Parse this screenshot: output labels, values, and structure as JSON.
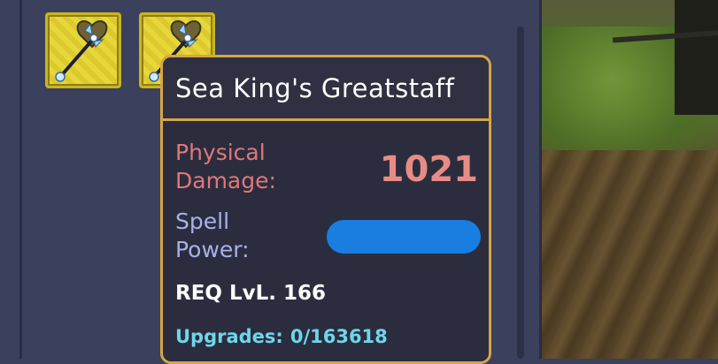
{
  "tooltip": {
    "item_name": "Sea King's Greatstaff",
    "physical_damage_label_line1": "Physical",
    "physical_damage_label_line2": "Damage:",
    "physical_damage_value": "1021",
    "spell_power_label_line1": "Spell",
    "spell_power_label_line2": "Power:",
    "req_level": "REQ LvL. 166",
    "upgrades_label": "Upgrades:",
    "upgrades_value": "0/163618"
  },
  "inventory": {
    "slots": [
      {
        "icon": "greatstaff-icon"
      },
      {
        "icon": "greatstaff-icon"
      }
    ]
  },
  "colors": {
    "tooltip_border": "#d8a545",
    "slot_yellow": "#e8d73a",
    "physical_damage": "#e07878",
    "spell_power": "#a9b0e8",
    "upgrades": "#6fd6ea",
    "redaction": "#1a7de0"
  }
}
